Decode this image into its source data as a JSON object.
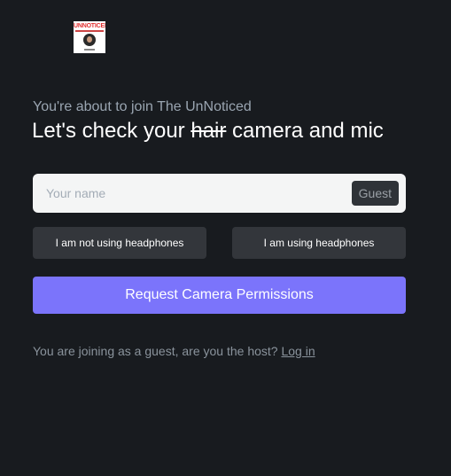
{
  "logo": {
    "text": "UNNOTICED",
    "brand_color": "#e03030"
  },
  "join": {
    "subtitle": "You're about to join The UnNoticed",
    "headline_before": "Let's check your ",
    "headline_strike": "hair",
    "headline_after": " camera and mic"
  },
  "name_field": {
    "placeholder": "Your name",
    "value": "",
    "badge": "Guest"
  },
  "headphones": {
    "not_using_label": "I am not using headphones",
    "using_label": "I am using headphones"
  },
  "request_button": {
    "label": "Request Camera Permissions",
    "color": "#7b74fb"
  },
  "footer": {
    "guest_text": "You are joining as a guest, are you the host? ",
    "login_label": "Log in"
  }
}
